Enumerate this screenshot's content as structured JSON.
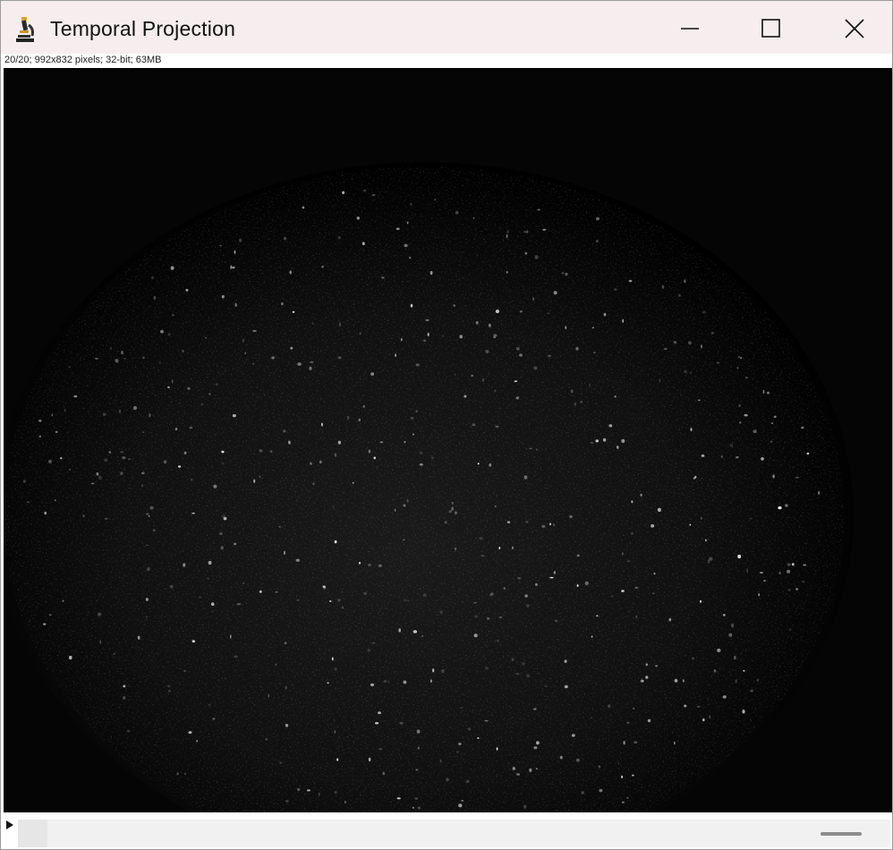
{
  "window": {
    "title": "Temporal Projection",
    "app_icon": "microscope-icon",
    "controls": [
      "minimize-icon",
      "maximize-icon",
      "close-icon"
    ]
  },
  "image": {
    "info": "20/20; 992x832 pixels; 32-bit; 63MB",
    "background_color": "#000000"
  },
  "slice_scroller": {
    "play_icon": "play-icon",
    "current_slice": 20,
    "total_slices": 20
  }
}
